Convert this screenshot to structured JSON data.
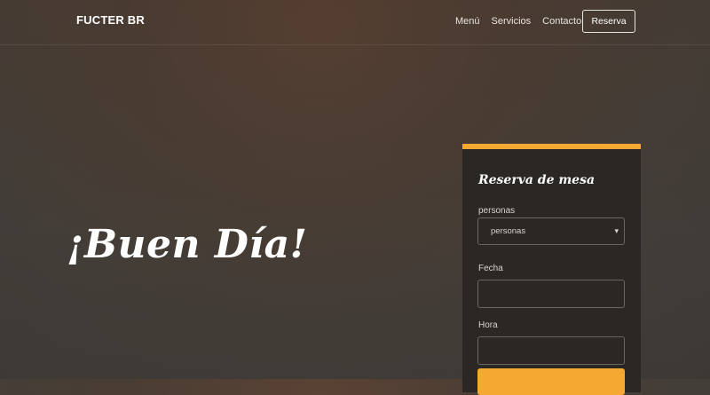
{
  "navbar": {
    "brand": "FUCTER BR",
    "links": [
      "Menú",
      "Servicios",
      "Contacto"
    ],
    "cta_label": "Reserva"
  },
  "hero": {
    "title": "¡Buen Día!"
  },
  "reservation_form": {
    "title": "Reserva de mesa",
    "people_label": "personas",
    "people_selected": "personas",
    "date_label": "Fecha",
    "time_label": "Hora"
  },
  "colors": {
    "accent": "#f5a932",
    "card_background": "#2b2724"
  },
  "icons": {
    "select_chevron": "chevron-down-icon"
  }
}
